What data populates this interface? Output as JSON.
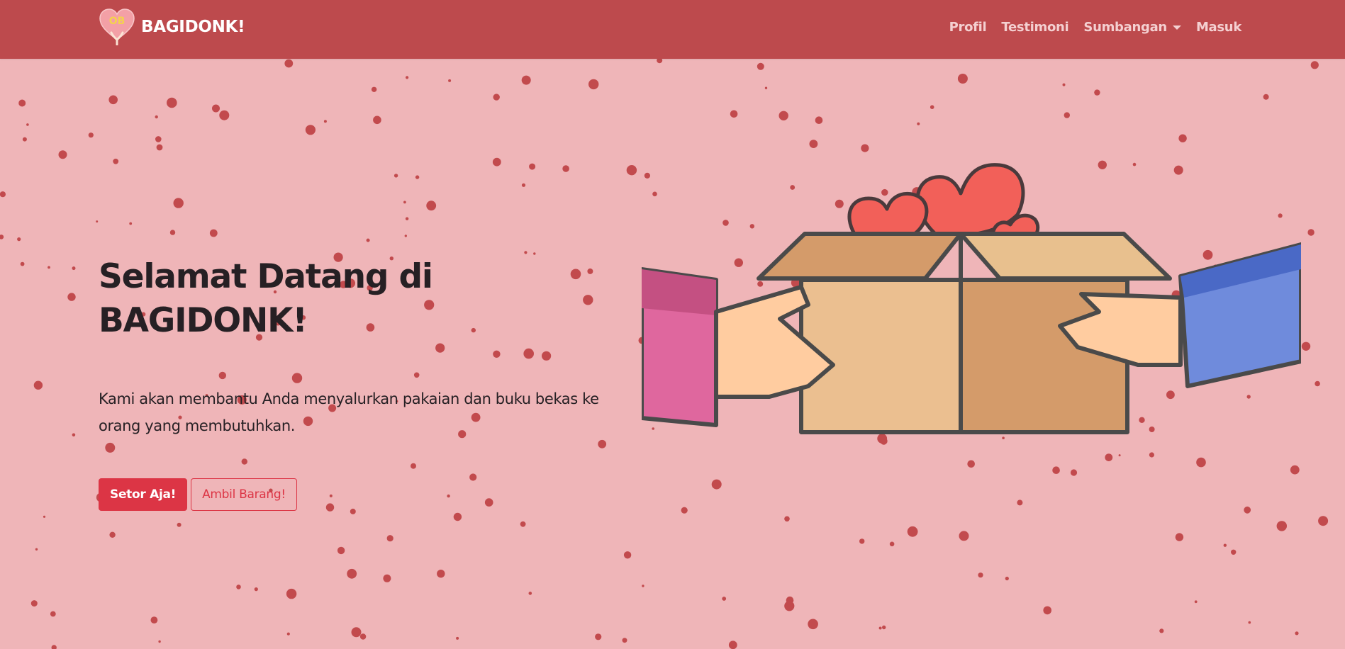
{
  "app": {
    "brand_name": "BAGIDONK!",
    "brand_logo_text": "OB"
  },
  "nav": {
    "items": [
      {
        "label": "Profil"
      },
      {
        "label": "Testimoni"
      },
      {
        "label": "Sumbangan",
        "has_dropdown": true
      },
      {
        "label": "Masuk"
      }
    ]
  },
  "hero": {
    "title": "Selamat Datang di BAGIDONK!",
    "description": "Kami akan membantu Anda menyalurkan pakaian dan buku bekas ke orang yang membutuhkan.",
    "primary_button": "Setor Aja!",
    "secondary_button": "Ambil Barang!"
  },
  "illustration": {
    "icon": "hands-giving-box-with-hearts-icon"
  },
  "colors": {
    "background": "#efb5b8",
    "navbar": "#bd4a4d",
    "accent": "#dc3545",
    "dots": "#c24a4d",
    "text": "#262024"
  }
}
